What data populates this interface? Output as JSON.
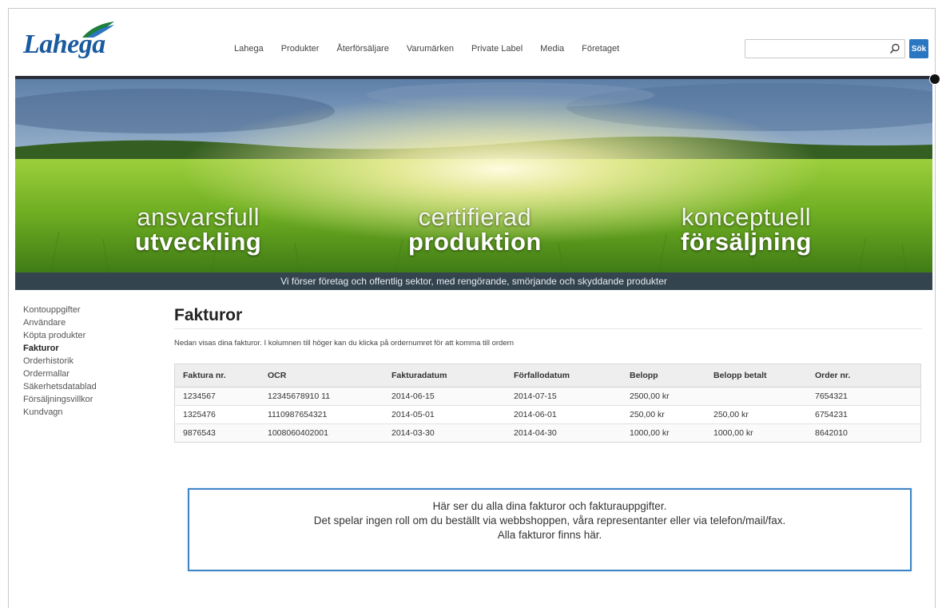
{
  "brand": {
    "logo_text": "Lahega",
    "accent": "#2b76c2",
    "logo_color": "#1a5a9e"
  },
  "nav": {
    "items": [
      "Lahega",
      "Produkter",
      "Återförsäljare",
      "Varumärken",
      "Private Label",
      "Media",
      "Företaget"
    ]
  },
  "search": {
    "value": "",
    "button_label": "Sök"
  },
  "banner": {
    "taglines": [
      {
        "light": "ansvarsfull",
        "bold": "utveckling"
      },
      {
        "light": "certifierad",
        "bold": "produktion"
      },
      {
        "light": "konceptuell",
        "bold": "försäljning"
      }
    ],
    "strip_text": "Vi förser företag och offentlig sektor, med rengörande, smörjande och skyddande produkter"
  },
  "sidebar": {
    "items": [
      "Kontouppgifter",
      "Användare",
      "Köpta produkter",
      "Fakturor",
      "Orderhistorik",
      "Ordermallar",
      "Säkerhetsdatablad",
      "Försäljningsvillkor",
      "Kundvagn"
    ],
    "active_index": 3
  },
  "main": {
    "title": "Fakturor",
    "intro": "Nedan visas dina fakturor. I kolumnen till höger kan du klicka på ordernumret för att komma till ordern",
    "table": {
      "headers": [
        "Faktura nr.",
        "OCR",
        "Fakturadatum",
        "Förfallodatum",
        "Belopp",
        "Belopp betalt",
        "Order nr."
      ],
      "rows": [
        [
          "1234567",
          "12345678910 11",
          "2014-06-15",
          "2014-07-15",
          "2500,00 kr",
          "",
          "7654321"
        ],
        [
          "1325476",
          "1110987654321",
          "2014-05-01",
          "2014-06-01",
          "250,00 kr",
          "250,00 kr",
          "6754231"
        ],
        [
          "9876543",
          "1008060402001",
          "2014-03-30",
          "2014-04-30",
          "1000,00 kr",
          "1000,00 kr",
          "8642010"
        ]
      ]
    },
    "info_box": {
      "line1": "Här ser du alla dina fakturor och fakturauppgifter.",
      "line2": "Det spelar ingen roll om du beställt via webbshoppen, våra representanter eller via telefon/mail/fax.",
      "line3": "Alla fakturor finns här."
    }
  }
}
